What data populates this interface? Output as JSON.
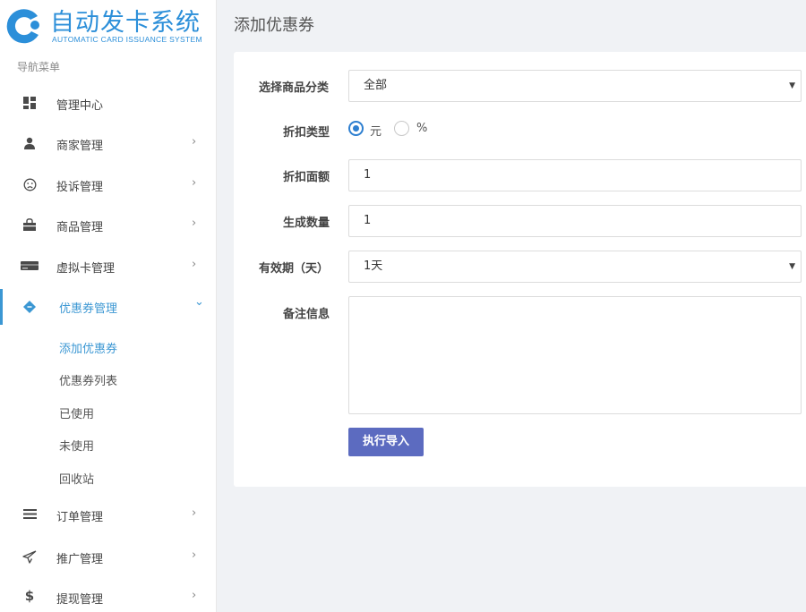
{
  "brand": {
    "title": "自动发卡系统",
    "subtitle": "AUTOMATIC CARD ISSUANCE SYSTEM",
    "color": "#2c8fd9"
  },
  "sidebar": {
    "caption": "导航菜单",
    "items": [
      {
        "label": "管理中心",
        "icon": "dashboard-icon",
        "arrow": ""
      },
      {
        "label": "商家管理",
        "icon": "user-icon",
        "arrow": "›"
      },
      {
        "label": "投诉管理",
        "icon": "frown-icon",
        "arrow": "›"
      },
      {
        "label": "商品管理",
        "icon": "shopping-bag-icon",
        "arrow": "›"
      },
      {
        "label": "虚拟卡管理",
        "icon": "card-icon",
        "arrow": "›"
      },
      {
        "label": "优惠券管理",
        "icon": "ticket-icon",
        "arrow": "⌄"
      },
      {
        "label": "订单管理",
        "icon": "list-icon",
        "arrow": "›"
      },
      {
        "label": "推广管理",
        "icon": "paper-plane-icon",
        "arrow": "›"
      },
      {
        "label": "提现管理",
        "icon": "dollar-icon",
        "arrow": "›"
      }
    ],
    "subitems": [
      "添加优惠券",
      "优惠券列表",
      "已使用",
      "未使用",
      "回收站"
    ],
    "active_color": "#3b97d3"
  },
  "page": {
    "title": "添加优惠券"
  },
  "form": {
    "category_label": "选择商品分类",
    "category_value": "全部",
    "discount_type_label": "折扣类型",
    "discount_type_options": [
      "元",
      "%"
    ],
    "discount_type_selected": "元",
    "amount_label": "折扣面额",
    "amount_value": "1",
    "quantity_label": "生成数量",
    "quantity_value": "1",
    "validity_label": "有效期（天）",
    "validity_value": "1天",
    "remark_label": "备注信息",
    "remark_value": "",
    "submit_label": "执行导入",
    "submit_color": "#5c6bc0"
  }
}
